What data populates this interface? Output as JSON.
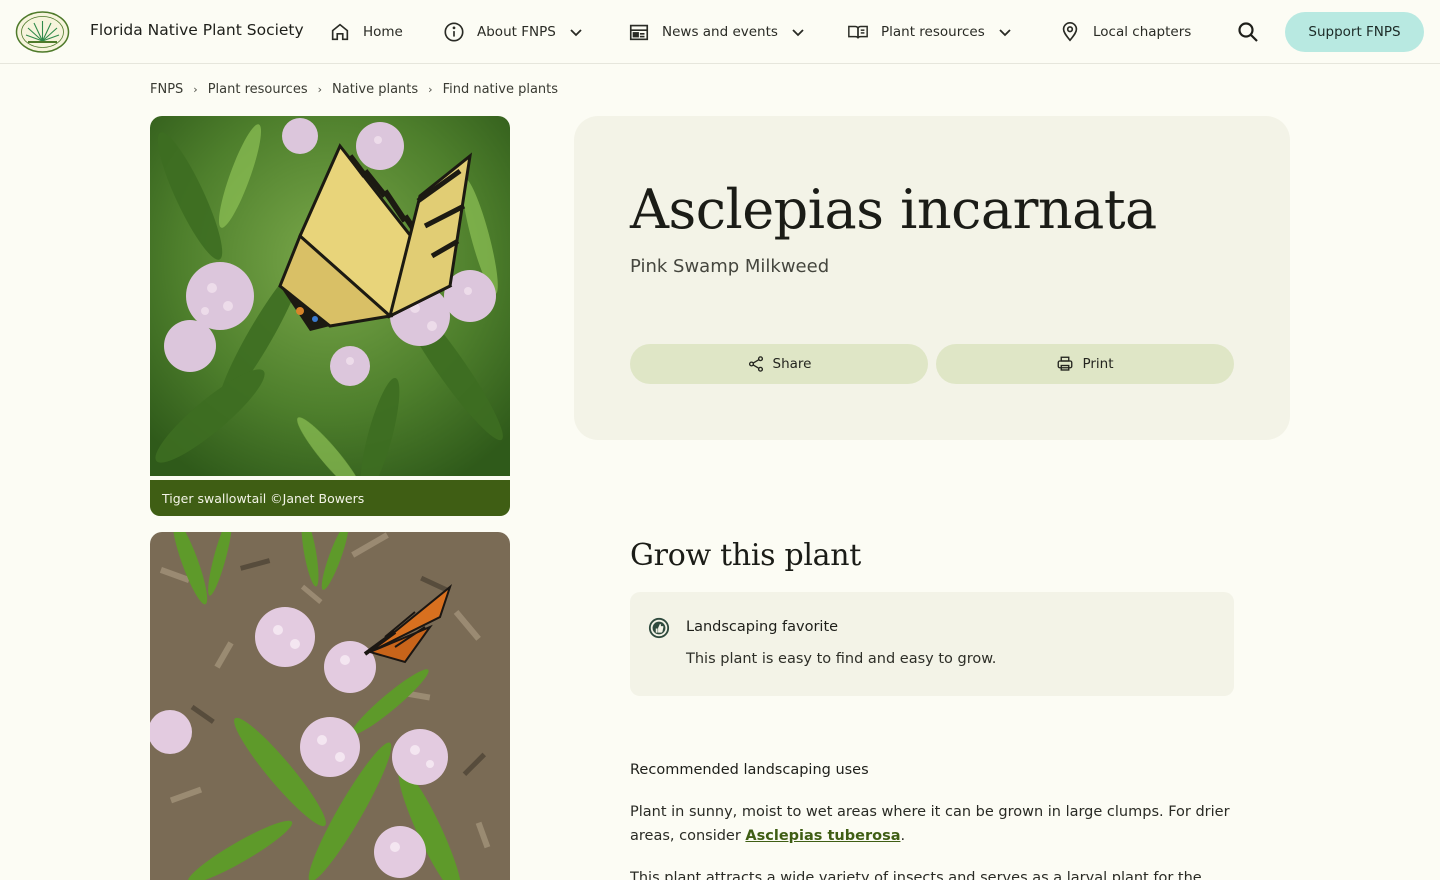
{
  "header": {
    "site_title": "Florida Native Plant Society",
    "logo_icon": "fnps-seal-logo",
    "nav": [
      {
        "label": "Home",
        "icon": "home-icon",
        "has_dropdown": false
      },
      {
        "label": "About FNPS",
        "icon": "info-icon",
        "has_dropdown": true
      },
      {
        "label": "News and events",
        "icon": "calendar-icon",
        "has_dropdown": true
      },
      {
        "label": "Plant resources",
        "icon": "book-icon",
        "has_dropdown": true
      },
      {
        "label": "Local chapters",
        "icon": "location-pin-icon",
        "has_dropdown": false
      }
    ],
    "search_icon": "search-icon",
    "support_label": "Support FNPS"
  },
  "breadcrumb": [
    "FNPS",
    "Plant resources",
    "Native plants",
    "Find native plants"
  ],
  "photos": [
    {
      "caption": "Tiger swallowtail ©Janet Bowers"
    },
    {
      "caption": ""
    }
  ],
  "plant": {
    "scientific_name": "Asclepias incarnata",
    "common_name": "Pink Swamp Milkweed",
    "share_label": "Share",
    "print_label": "Print"
  },
  "grow": {
    "heading": "Grow this plant",
    "favorite_title": "Landscaping favorite",
    "favorite_desc": "This plant is easy to find and easy to grow.",
    "uses_heading": "Recommended landscaping uses",
    "uses_text_before": "Plant in sunny, moist to wet areas where it can be grown in large clumps. For drier areas, consider ",
    "uses_link": "Asclepias tuberosa",
    "uses_text_after": ".",
    "more_text": "This plant attracts a wide variety of insects and serves as a larval plant for the"
  },
  "colors": {
    "background": "#fcfcf4",
    "card": "#f3f3e7",
    "accent_green": "#3f5e14",
    "support_button": "#b8e9e1",
    "action_button": "#dfe6c6"
  }
}
